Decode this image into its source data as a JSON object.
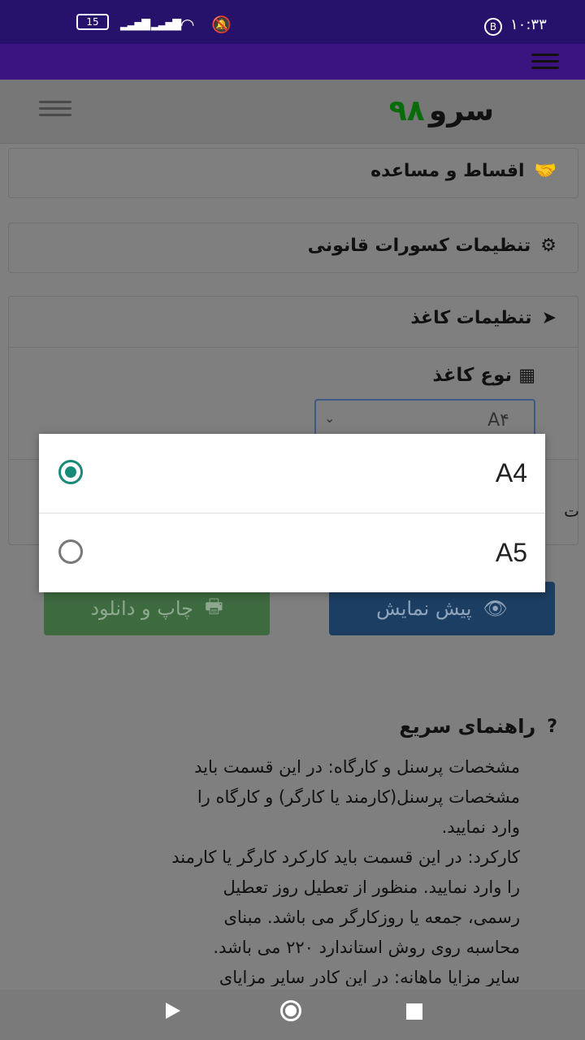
{
  "status_bar": {
    "battery": "15",
    "time": "۱۰:۳۳",
    "badge": "B"
  },
  "header": {
    "logo_word": "سرو",
    "logo_number": "۹۸"
  },
  "sections": {
    "installments": "اقساط و مساعده",
    "legal_deductions": "تنظیمات کسورات قانونی",
    "paper_settings": "تنظیمات کاغذ",
    "paper_type_label": "نوع کاغذ",
    "paper_type_value": "A۴",
    "partial_char": "ت"
  },
  "buttons": {
    "print_download": "چاپ و دانلود",
    "preview": "پیش نمایش"
  },
  "guide": {
    "title": "راهنمای سریع",
    "lines": [
      "مشخصات پرسنل و کارگاه: در این قسمت باید",
      "مشخصات پرسنل(کارمند یا کارگر) و کارگاه را",
      "وارد نمایید.",
      "کارکرد: در این قسمت باید کارکرد کارگر یا کارمند",
      "را وارد نمایید. منظور از تعطیل روز تعطیل",
      "رسمی، جمعه یا روزکارگر می باشد. مبنای",
      "محاسبه روی روش استاندارد ۲۲۰ می باشد.",
      "سایر مزایا ماهانه: در این کادر سایر مزایای"
    ]
  },
  "dialog": {
    "options": [
      {
        "label": "A4",
        "selected": true
      },
      {
        "label": "A5",
        "selected": false
      }
    ]
  },
  "colors": {
    "radio_accent": "#178a78",
    "status_bar": "#26126a",
    "app_bar": "#3c1481",
    "logo_number": "#0a6b0a"
  }
}
